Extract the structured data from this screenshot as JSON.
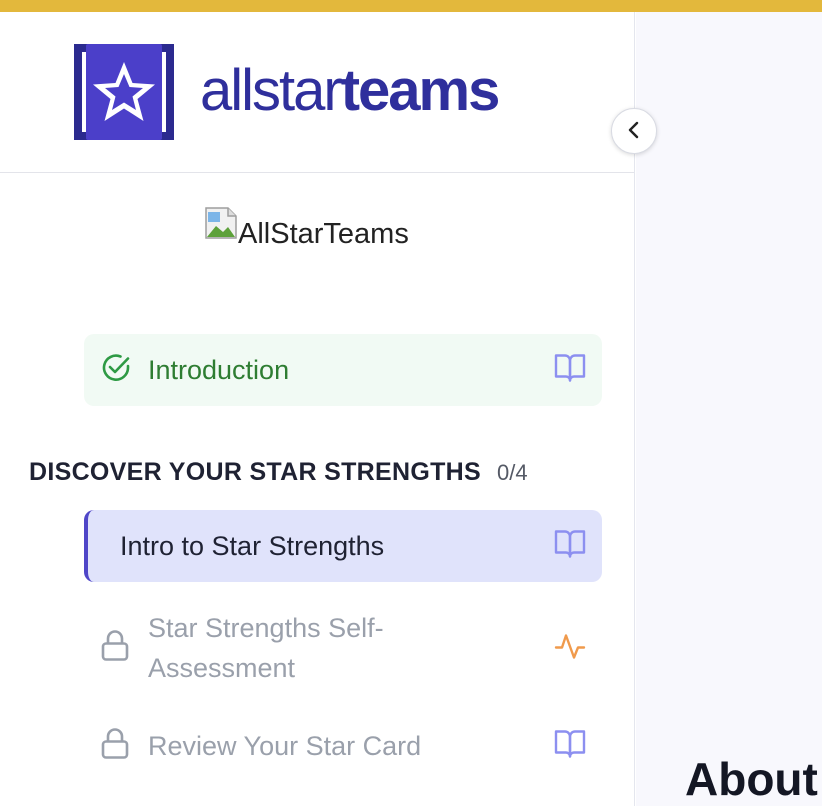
{
  "brand": {
    "logo_light": "allstar",
    "logo_bold": "teams",
    "logo_color": "#2f2f9c",
    "logo_mark_color": "#4b3fc9",
    "accent_top_bar": "#e3b83c"
  },
  "sidebar": {
    "collapse_icon": "chevron-left-icon",
    "image_alt": "AllStarTeams",
    "items": [
      {
        "label": "Introduction",
        "status": "completed",
        "left_icon": "check-circle-icon",
        "right_icon": "book-icon"
      }
    ],
    "section": {
      "title": "DISCOVER YOUR STAR STRENGTHS",
      "count": "0/4",
      "items": [
        {
          "label": "Intro to Star Strengths",
          "status": "active",
          "right_icon": "book-icon"
        },
        {
          "label": "Star Strengths Self-Assessment",
          "status": "locked",
          "left_icon": "lock-icon",
          "right_icon": "activity-icon"
        },
        {
          "label": "Review Your Star Card",
          "status": "locked",
          "left_icon": "lock-icon",
          "right_icon": "book-icon"
        }
      ]
    }
  },
  "main": {
    "heading": "About"
  }
}
